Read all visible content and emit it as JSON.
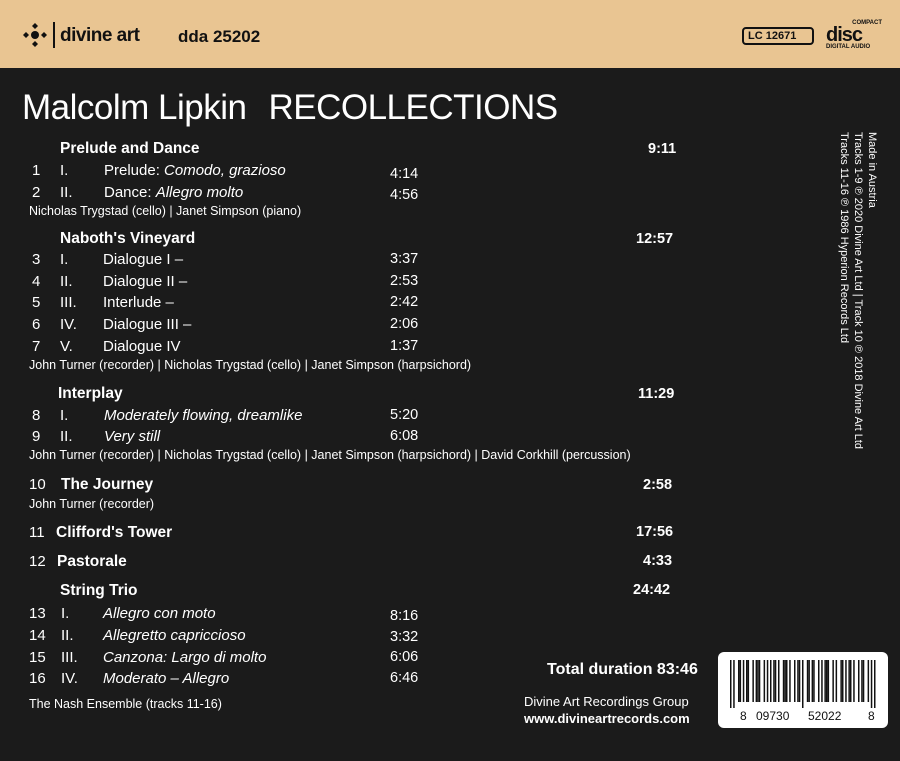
{
  "header": {
    "brand": "divine art",
    "catalog": "dda 25202",
    "lc": "LC 12671",
    "cd_top": "COMPACT",
    "cd_main": "disc",
    "cd_bottom": "DIGITAL AUDIO"
  },
  "title": {
    "composer": "Malcolm Lipkin",
    "album": "RECOLLECTIONS"
  },
  "works": {
    "w1": {
      "title": "Prelude and Dance",
      "duration": "9:11",
      "tracks": [
        {
          "num": "1",
          "mov": "I.",
          "name_plain": "Prelude: ",
          "name_italic": "Comodo, grazioso",
          "time": "4:14"
        },
        {
          "num": "2",
          "mov": "II.",
          "name_plain": "Dance: ",
          "name_italic": "Allegro molto",
          "time": "4:56"
        }
      ],
      "performers": "Nicholas Trygstad  (cello) | Janet Simpson (piano)"
    },
    "w2": {
      "title": "Naboth's Vineyard",
      "duration": "12:57",
      "tracks": [
        {
          "num": "3",
          "mov": "I.",
          "name": "Dialogue I –",
          "time": "3:37"
        },
        {
          "num": "4",
          "mov": "II.",
          "name": "Dialogue II –",
          "time": "2:53"
        },
        {
          "num": "5",
          "mov": "III.",
          "name": "Interlude –",
          "time": "2:42"
        },
        {
          "num": "6",
          "mov": "IV.",
          "name": "Dialogue III –",
          "time": "2:06"
        },
        {
          "num": "7",
          "mov": "V.",
          "name": "Dialogue IV",
          "time": "1:37"
        }
      ],
      "performers": "John Turner (recorder) | Nicholas Trygstad  (cello) | Janet Simpson (harpsichord)"
    },
    "w3": {
      "title": "Interplay",
      "duration": "11:29",
      "tracks": [
        {
          "num": "8",
          "mov": "I.",
          "name": "Moderately flowing, dreamlike",
          "time": "5:20"
        },
        {
          "num": "9",
          "mov": "II.",
          "name": "Very still",
          "time": "6:08"
        }
      ],
      "performers": "John Turner (recorder) | Nicholas Trygstad  (cello) | Janet Simpson (harpsichord) | David Corkhill (percussion)"
    },
    "w4": {
      "num": "10",
      "title": "The Journey",
      "duration": "2:58",
      "performers": "John Turner (recorder)"
    },
    "w5": {
      "num": "11",
      "title": "Clifford's Tower",
      "duration": "17:56"
    },
    "w6": {
      "num": "12",
      "title": "Pastorale",
      "duration": "4:33"
    },
    "w7": {
      "title": "String Trio",
      "duration": "24:42",
      "tracks": [
        {
          "num": "13",
          "mov": "I.",
          "name": "Allegro con moto",
          "time": "8:16"
        },
        {
          "num": "14",
          "mov": "II.",
          "name": "Allegretto capriccioso",
          "time": "3:32"
        },
        {
          "num": "15",
          "mov": "III.",
          "name": "Canzona: Largo di molto",
          "time": "6:06"
        },
        {
          "num": "16",
          "mov": "IV.",
          "name": "Moderato – Allegro",
          "time": "6:46"
        }
      ],
      "performers": "The Nash Ensemble  (tracks 11-16)"
    }
  },
  "footer": {
    "total": "Total duration 83:46",
    "group": "Divine Art Recordings Group",
    "website": "www.divineartrecords.com",
    "barcode": {
      "d1": "8",
      "d2": "09730",
      "d3": "52022",
      "d4": "8"
    }
  },
  "side": {
    "line1": "Made in Austria",
    "line2": "Tracks 1-9 ℗ 2020 Divine Art Ltd   |   Track 10 ℗ 2018 Divine Art Ltd",
    "line3": "Tracks 11-16 ℗ 1986 Hyperion Records Ltd"
  }
}
